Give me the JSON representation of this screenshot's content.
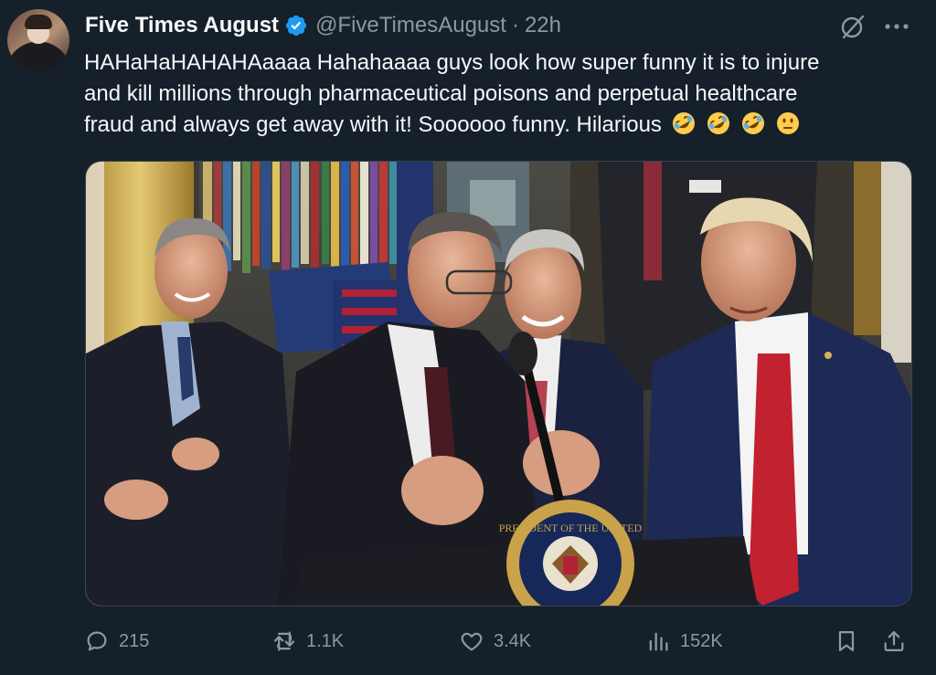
{
  "author": {
    "display_name": "Five Times August",
    "handle": "@FiveTimesAugust",
    "separator": "·",
    "time": "22h",
    "verified": true
  },
  "tweet": {
    "text_lines": [
      "HAHaHaHAHAHAaaaa Hahahaaaa guys look how super funny it is to injure",
      "and kill millions through pharmaceutical poisons and perpetual healthcare",
      "fraud and always get away with it! Soooooo funny. Hilarious"
    ],
    "trailing_emoji": [
      "rolling-on-floor-laughing",
      "rolling-on-floor-laughing",
      "rolling-on-floor-laughing",
      "neutral-face"
    ]
  },
  "media": {
    "type": "photo",
    "seal_text": "PRESIDENT OF THE UNITED"
  },
  "actions": {
    "replies": "215",
    "retweets": "1.1K",
    "likes": "3.4K",
    "views": "152K"
  },
  "colors": {
    "background": "#15202b",
    "text": "#f7f9f9",
    "secondary": "#8b98a5",
    "verified": "#1d9bf0"
  }
}
